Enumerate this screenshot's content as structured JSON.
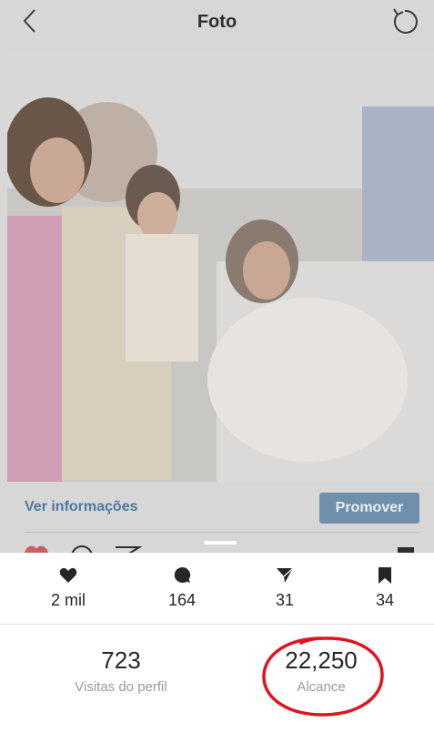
{
  "header": {
    "title": "Foto",
    "back_icon": "chevron-left-icon",
    "refresh_icon": "refresh-icon"
  },
  "post": {
    "view_info_label": "Ver informações",
    "promote_label": "Promover"
  },
  "stats": [
    {
      "icon": "heart-icon",
      "value": "2 mil"
    },
    {
      "icon": "comment-icon",
      "value": "164"
    },
    {
      "icon": "send-icon",
      "value": "31"
    },
    {
      "icon": "bookmark-icon",
      "value": "34"
    }
  ],
  "summary": {
    "profile_visits": {
      "value": "723",
      "label": "Visitas do perfil"
    },
    "reach": {
      "value": "22,250",
      "label": "Alcance"
    }
  },
  "colors": {
    "link": "#4e7a9e",
    "promote_bg": "#6f8fab",
    "highlight_circle": "#e0141e",
    "dim_overlay": "#d7d7d7"
  }
}
